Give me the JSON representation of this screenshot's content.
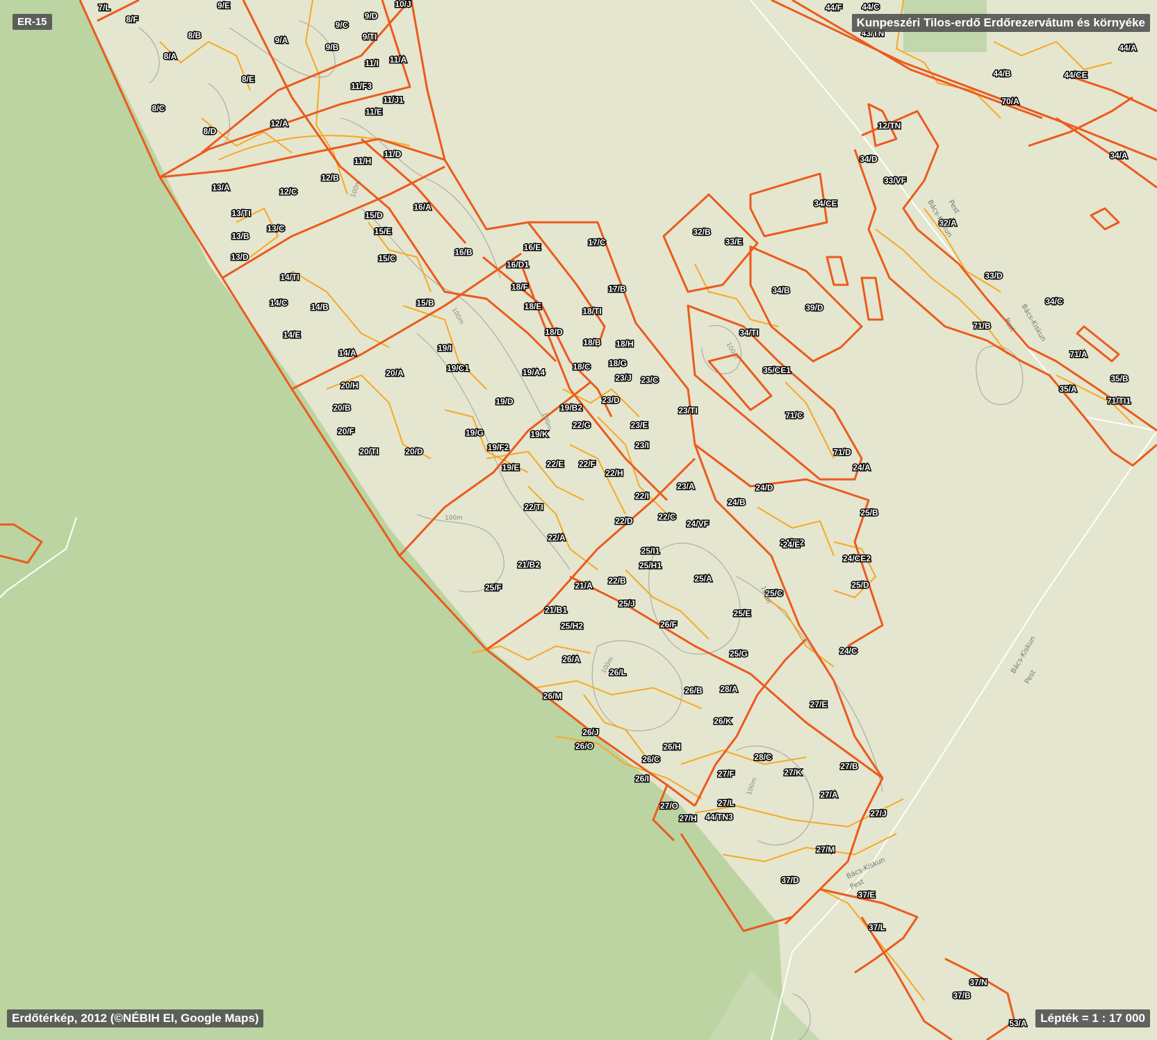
{
  "map": {
    "sheet_id": "ER-15",
    "title": "Kunpeszéri Tilos-erdő Erdőrezervátum és környéke",
    "credit": "Erdőtérkép, 2012 (©NÉBIH EI, Google Maps)",
    "scale": "Lépték = 1 : 17 000",
    "colors": {
      "background": "#e4e6cf",
      "green_area": "#bbd4a2",
      "subcompartment_line": "#f7a823",
      "compartment_line": "#ec5a1c",
      "contour": "#a9a9a0",
      "county_border": "#ffffff"
    },
    "contour_labels": [
      "100m",
      "100m",
      "100m",
      "100m",
      "100m",
      "100m",
      "100m",
      "100m"
    ],
    "county_labels": [
      "Pest",
      "Bács-Kiskun",
      "Bács-Kiskun",
      "Pest",
      "Bács-Kiskun",
      "Pest",
      "Bács-Kiskun",
      "Pest"
    ],
    "labels": [
      "7/L",
      "8/F",
      "9/E",
      "9/D",
      "10/J",
      "8/B",
      "9/A",
      "9/C",
      "9/TI",
      "9/B",
      "8/A",
      "11/I",
      "11/A",
      "8/E",
      "11/F3",
      "11/J1",
      "8/C",
      "11/E",
      "12/A",
      "8/D",
      "11/D",
      "11/H",
      "12/B",
      "13/A",
      "12/C",
      "16/A",
      "15/D",
      "13/TI",
      "13/C",
      "15/E",
      "13/B",
      "15/C",
      "16/E",
      "17/C",
      "13/D",
      "16/B",
      "16/D1",
      "14/TI",
      "18/F",
      "17/B",
      "14/C",
      "14/B",
      "15/B",
      "18/E",
      "18/TI",
      "14/E",
      "18/D",
      "18/B",
      "18/H",
      "19/I",
      "14/A",
      "18/C",
      "18/G",
      "19/C1",
      "20/A",
      "19/A4",
      "23/J",
      "23/C",
      "20/H",
      "19/D",
      "23/D",
      "20/B",
      "19/B2",
      "22/G",
      "23/TI",
      "20/F",
      "19/G",
      "19/K",
      "23/E",
      "19/F2",
      "23/I",
      "20/TI",
      "20/D",
      "19/E",
      "22/E",
      "22/F",
      "22/H",
      "23/A",
      "22/TI",
      "22/I",
      "22/C",
      "22/D",
      "22/A",
      "25/I1",
      "21/B2",
      "25/H1",
      "25/F",
      "22/B",
      "21/A",
      "25/J",
      "21/B1",
      "25/H2",
      "26/F",
      "26/A",
      "26/L",
      "26/M",
      "26/B",
      "26/K",
      "26/J",
      "26/O",
      "26/H",
      "26/C",
      "26/I",
      "27/O",
      "27/H",
      "44/TN3",
      "44/F",
      "44/C",
      "43/TN",
      "44/A",
      "44/B",
      "44/CE",
      "70/A",
      "12/TN",
      "34/A",
      "34/D",
      "33/VF",
      "34/CE",
      "32/A",
      "32/B",
      "33/E",
      "34/B",
      "33/D",
      "39/D",
      "34/C",
      "71/B",
      "34/TI",
      "71/A",
      "35/CE1",
      "35/B",
      "35/A",
      "71/TI1",
      "71/C",
      "71/D",
      "24/A",
      "24/D",
      "24/B",
      "25/B",
      "24/VF",
      "24/TI2",
      "24/E",
      "24/CE2",
      "25/D",
      "25/A",
      "25/C",
      "25/E",
      "24/C",
      "25/G",
      "28/A",
      "27/E",
      "28/C",
      "27/B",
      "27/F",
      "27/K",
      "27/A",
      "27/L",
      "27/J",
      "27/M",
      "37/D",
      "37/E",
      "37/L",
      "37/N",
      "37/B",
      "53/A"
    ]
  }
}
